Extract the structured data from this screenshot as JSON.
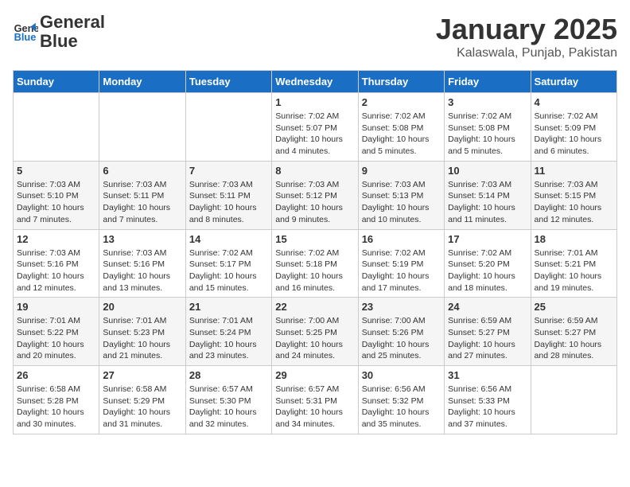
{
  "logo": {
    "general": "General",
    "blue": "Blue"
  },
  "header": {
    "month": "January 2025",
    "location": "Kalaswala, Punjab, Pakistan"
  },
  "weekdays": [
    "Sunday",
    "Monday",
    "Tuesday",
    "Wednesday",
    "Thursday",
    "Friday",
    "Saturday"
  ],
  "weeks": [
    [
      {
        "day": "",
        "info": ""
      },
      {
        "day": "",
        "info": ""
      },
      {
        "day": "",
        "info": ""
      },
      {
        "day": "1",
        "info": "Sunrise: 7:02 AM\nSunset: 5:07 PM\nDaylight: 10 hours\nand 4 minutes."
      },
      {
        "day": "2",
        "info": "Sunrise: 7:02 AM\nSunset: 5:08 PM\nDaylight: 10 hours\nand 5 minutes."
      },
      {
        "day": "3",
        "info": "Sunrise: 7:02 AM\nSunset: 5:08 PM\nDaylight: 10 hours\nand 5 minutes."
      },
      {
        "day": "4",
        "info": "Sunrise: 7:02 AM\nSunset: 5:09 PM\nDaylight: 10 hours\nand 6 minutes."
      }
    ],
    [
      {
        "day": "5",
        "info": "Sunrise: 7:03 AM\nSunset: 5:10 PM\nDaylight: 10 hours\nand 7 minutes."
      },
      {
        "day": "6",
        "info": "Sunrise: 7:03 AM\nSunset: 5:11 PM\nDaylight: 10 hours\nand 7 minutes."
      },
      {
        "day": "7",
        "info": "Sunrise: 7:03 AM\nSunset: 5:11 PM\nDaylight: 10 hours\nand 8 minutes."
      },
      {
        "day": "8",
        "info": "Sunrise: 7:03 AM\nSunset: 5:12 PM\nDaylight: 10 hours\nand 9 minutes."
      },
      {
        "day": "9",
        "info": "Sunrise: 7:03 AM\nSunset: 5:13 PM\nDaylight: 10 hours\nand 10 minutes."
      },
      {
        "day": "10",
        "info": "Sunrise: 7:03 AM\nSunset: 5:14 PM\nDaylight: 10 hours\nand 11 minutes."
      },
      {
        "day": "11",
        "info": "Sunrise: 7:03 AM\nSunset: 5:15 PM\nDaylight: 10 hours\nand 12 minutes."
      }
    ],
    [
      {
        "day": "12",
        "info": "Sunrise: 7:03 AM\nSunset: 5:16 PM\nDaylight: 10 hours\nand 12 minutes."
      },
      {
        "day": "13",
        "info": "Sunrise: 7:03 AM\nSunset: 5:16 PM\nDaylight: 10 hours\nand 13 minutes."
      },
      {
        "day": "14",
        "info": "Sunrise: 7:02 AM\nSunset: 5:17 PM\nDaylight: 10 hours\nand 15 minutes."
      },
      {
        "day": "15",
        "info": "Sunrise: 7:02 AM\nSunset: 5:18 PM\nDaylight: 10 hours\nand 16 minutes."
      },
      {
        "day": "16",
        "info": "Sunrise: 7:02 AM\nSunset: 5:19 PM\nDaylight: 10 hours\nand 17 minutes."
      },
      {
        "day": "17",
        "info": "Sunrise: 7:02 AM\nSunset: 5:20 PM\nDaylight: 10 hours\nand 18 minutes."
      },
      {
        "day": "18",
        "info": "Sunrise: 7:01 AM\nSunset: 5:21 PM\nDaylight: 10 hours\nand 19 minutes."
      }
    ],
    [
      {
        "day": "19",
        "info": "Sunrise: 7:01 AM\nSunset: 5:22 PM\nDaylight: 10 hours\nand 20 minutes."
      },
      {
        "day": "20",
        "info": "Sunrise: 7:01 AM\nSunset: 5:23 PM\nDaylight: 10 hours\nand 21 minutes."
      },
      {
        "day": "21",
        "info": "Sunrise: 7:01 AM\nSunset: 5:24 PM\nDaylight: 10 hours\nand 23 minutes."
      },
      {
        "day": "22",
        "info": "Sunrise: 7:00 AM\nSunset: 5:25 PM\nDaylight: 10 hours\nand 24 minutes."
      },
      {
        "day": "23",
        "info": "Sunrise: 7:00 AM\nSunset: 5:26 PM\nDaylight: 10 hours\nand 25 minutes."
      },
      {
        "day": "24",
        "info": "Sunrise: 6:59 AM\nSunset: 5:27 PM\nDaylight: 10 hours\nand 27 minutes."
      },
      {
        "day": "25",
        "info": "Sunrise: 6:59 AM\nSunset: 5:27 PM\nDaylight: 10 hours\nand 28 minutes."
      }
    ],
    [
      {
        "day": "26",
        "info": "Sunrise: 6:58 AM\nSunset: 5:28 PM\nDaylight: 10 hours\nand 30 minutes."
      },
      {
        "day": "27",
        "info": "Sunrise: 6:58 AM\nSunset: 5:29 PM\nDaylight: 10 hours\nand 31 minutes."
      },
      {
        "day": "28",
        "info": "Sunrise: 6:57 AM\nSunset: 5:30 PM\nDaylight: 10 hours\nand 32 minutes."
      },
      {
        "day": "29",
        "info": "Sunrise: 6:57 AM\nSunset: 5:31 PM\nDaylight: 10 hours\nand 34 minutes."
      },
      {
        "day": "30",
        "info": "Sunrise: 6:56 AM\nSunset: 5:32 PM\nDaylight: 10 hours\nand 35 minutes."
      },
      {
        "day": "31",
        "info": "Sunrise: 6:56 AM\nSunset: 5:33 PM\nDaylight: 10 hours\nand 37 minutes."
      },
      {
        "day": "",
        "info": ""
      }
    ]
  ]
}
